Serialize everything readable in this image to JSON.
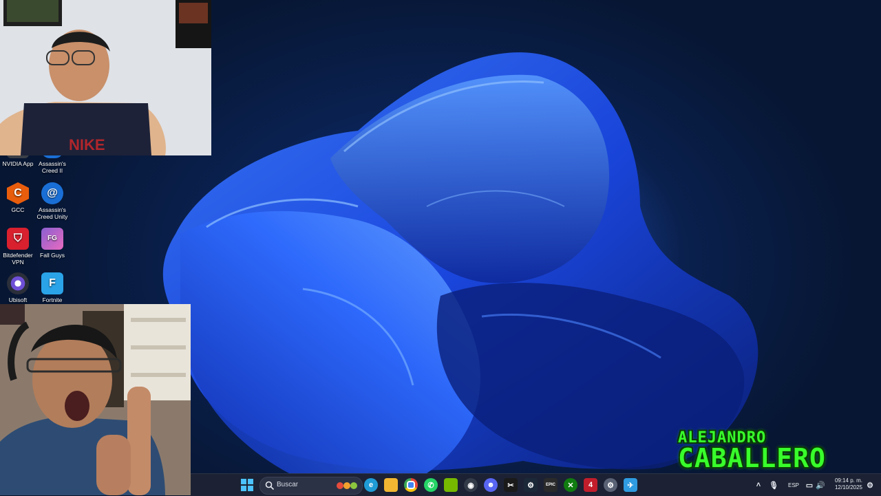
{
  "desktop_icons": [
    {
      "label": "NVIDIA App",
      "icon": "nvidia-app-icon",
      "color": "#3a3f47"
    },
    {
      "label": "Assassin's Creed II",
      "icon": "ubisoft-swirl-icon",
      "color": "#1a6fd6"
    },
    {
      "label": "GCC",
      "icon": "gcc-hexagon-icon",
      "color": "#e85d0c"
    },
    {
      "label": "Assassin's Creed Unity",
      "icon": "ubisoft-swirl-icon",
      "color": "#1a6fd6"
    },
    {
      "label": "Bitdefender VPN",
      "icon": "bitdefender-shield-icon",
      "color": "#d8202f"
    },
    {
      "label": "Fall Guys",
      "icon": "fall-guys-icon",
      "color": "#8a5fd1"
    },
    {
      "label": "Ubisoft",
      "icon": "ubisoft-swirl-icon",
      "color": "#2b2f3a"
    },
    {
      "label": "Fortnite",
      "icon": "fortnite-icon",
      "color": "#2aa3e8"
    }
  ],
  "watermark": {
    "first": "ALEJANDRO",
    "last": "CABALLERO",
    "color": "#38ff2b"
  },
  "taskbar": {
    "search_label": "Buscar",
    "pinned": [
      {
        "name": "edge-icon",
        "glyph": "e",
        "color": "#1f9bd6"
      },
      {
        "name": "file-explorer-icon",
        "glyph": "",
        "color": "#f2b632"
      },
      {
        "name": "chrome-icon",
        "glyph": "",
        "color": "#e7453a"
      },
      {
        "name": "whatsapp-icon",
        "glyph": "✆",
        "color": "#25d366"
      },
      {
        "name": "nvidia-icon",
        "glyph": "",
        "color": "#76b900"
      },
      {
        "name": "obs-icon",
        "glyph": "◉",
        "color": "#333a48"
      },
      {
        "name": "discord-icon",
        "glyph": "☻",
        "color": "#5865f2"
      },
      {
        "name": "capcut-icon",
        "glyph": "✂",
        "color": "#1a1a1a"
      },
      {
        "name": "steam-icon",
        "glyph": "⚙",
        "color": "#1b2838"
      },
      {
        "name": "epic-games-icon",
        "glyph": "EPIC",
        "color": "#2a2a2a"
      },
      {
        "name": "xbox-icon",
        "glyph": "✕",
        "color": "#107c10"
      },
      {
        "name": "4-app-icon",
        "glyph": "4",
        "color": "#c21d2b"
      },
      {
        "name": "settings-icon",
        "glyph": "⚙",
        "color": "#5a6275"
      },
      {
        "name": "bird-app-icon",
        "glyph": "✈",
        "color": "#2f9be0"
      }
    ],
    "language": "ESP",
    "time": "09:14 p. m.",
    "date": "12/10/2025"
  }
}
